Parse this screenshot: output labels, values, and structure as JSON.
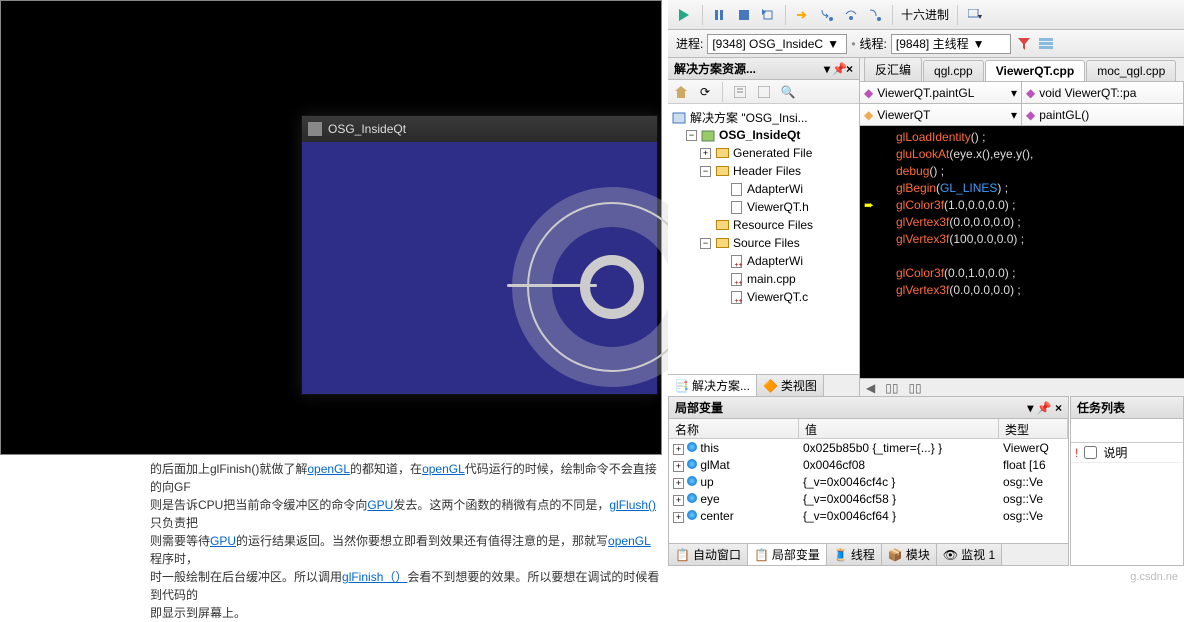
{
  "qt_window": {
    "title": "OSG_InsideQt"
  },
  "toolbar": {
    "hex_label": "十六进制"
  },
  "process_bar": {
    "process_label": "进程:",
    "process_value": "[9348] OSG_InsideC",
    "thread_label": "线程:",
    "thread_value": "[9848] 主线程"
  },
  "solution_panel": {
    "title": "解决方案资源...",
    "root": "解决方案 \"OSG_Insi...",
    "project": "OSG_InsideQt",
    "folders": {
      "generated": "Generated File",
      "header": "Header Files",
      "resource": "Resource Files",
      "source": "Source Files"
    },
    "files": {
      "adapterwi_h": "AdapterWi",
      "viewerqt_h": "ViewerQT.h",
      "adapterwi_c": "AdapterWi",
      "main_cpp": "main.cpp",
      "viewerqt_c": "ViewerQT.c"
    },
    "bottom_tabs": {
      "sol": "解决方案...",
      "class": "类视图"
    }
  },
  "editor": {
    "tabs": {
      "disasm": "反汇编",
      "qgl": "qgl.cpp",
      "viewerqt": "ViewerQT.cpp",
      "moc": "moc_qgl.cpp"
    },
    "nav1": {
      "left": "ViewerQT.paintGL",
      "right": "void ViewerQT::pa"
    },
    "nav2": {
      "left": "ViewerQT",
      "right": "paintGL()"
    },
    "code": [
      {
        "fn": "glLoadIdentity",
        "args": "()",
        "tail": ";"
      },
      {
        "fn": "gluLookAt",
        "args": "(eye.x(),eye.y(),",
        "tail": ""
      },
      {
        "fn": "debug",
        "args": "()",
        "tail": ";"
      },
      {
        "fn": "glBegin",
        "args_pre": "(",
        "kw": "GL_LINES",
        "args_post": ")",
        "tail": ";"
      },
      {
        "fn": "glColor3f",
        "args": "(1.0,0.0,0.0)",
        "tail": ";"
      },
      {
        "fn": "glVertex3f",
        "args": "(0.0,0.0,0.0)",
        "tail": ";"
      },
      {
        "fn": "glVertex3f",
        "args": "(100,0.0,0.0)",
        "tail": ";"
      },
      {
        "blank": true
      },
      {
        "fn": "glColor3f",
        "args": "(0.0,1.0,0.0)",
        "tail": ";"
      },
      {
        "fn": "glVertex3f",
        "args": "(0.0,0.0,0.0)",
        "tail": ";"
      }
    ]
  },
  "locals": {
    "title": "局部变量",
    "cols": {
      "name": "名称",
      "value": "值",
      "type": "类型"
    },
    "rows": [
      {
        "name": "this",
        "value": "0x025b85b0 {_timer={...} }",
        "type": "ViewerQ"
      },
      {
        "name": "glMat",
        "value": "0x0046cf08",
        "type": "float [16"
      },
      {
        "name": "up",
        "value": "{_v=0x0046cf4c }",
        "type": "osg::Ve"
      },
      {
        "name": "eye",
        "value": "{_v=0x0046cf58 }",
        "type": "osg::Ve"
      },
      {
        "name": "center",
        "value": "{_v=0x0046cf64 }",
        "type": "osg::Ve"
      }
    ],
    "bottom_tabs": {
      "auto": "自动窗口",
      "locals": "局部变量",
      "thread": "线程",
      "module": "模块",
      "watch": "监视 1"
    }
  },
  "tasks": {
    "title": "任务列表",
    "col": "说明"
  },
  "hint": {
    "l1_a": "的后面加上glFinish()就做了解",
    "l1_link1": "openGL",
    "l1_b": "的都知道，在",
    "l1_link2": "openGL",
    "l1_c": "代码运行的时候，绘制命令不会直接的向GF",
    "l2_a": "则是告诉CPU把当前命令缓冲区的命令向",
    "l2_link": "GPU",
    "l2_b": "发去。这两个函数的稍微有点的不同是，",
    "l2_link2": "glFlush()",
    "l2_c": "只负责把",
    "l3_a": "则需要等待",
    "l3_link": "GPU",
    "l3_b": "的运行结果返回。当然你要想立即看到效果还有值得注意的是，那就写",
    "l3_link2": "openGL",
    "l3_c": "程序时，",
    "l4_a": "时一般绘制在后台缓冲区。所以调用",
    "l4_link": "glFinish（）",
    "l4_b": "会看不到想要的效果。所以要想在调试的时候看到代码的",
    "l5": "即显示到屏幕上。"
  },
  "watermark": "g.csdn.ne"
}
